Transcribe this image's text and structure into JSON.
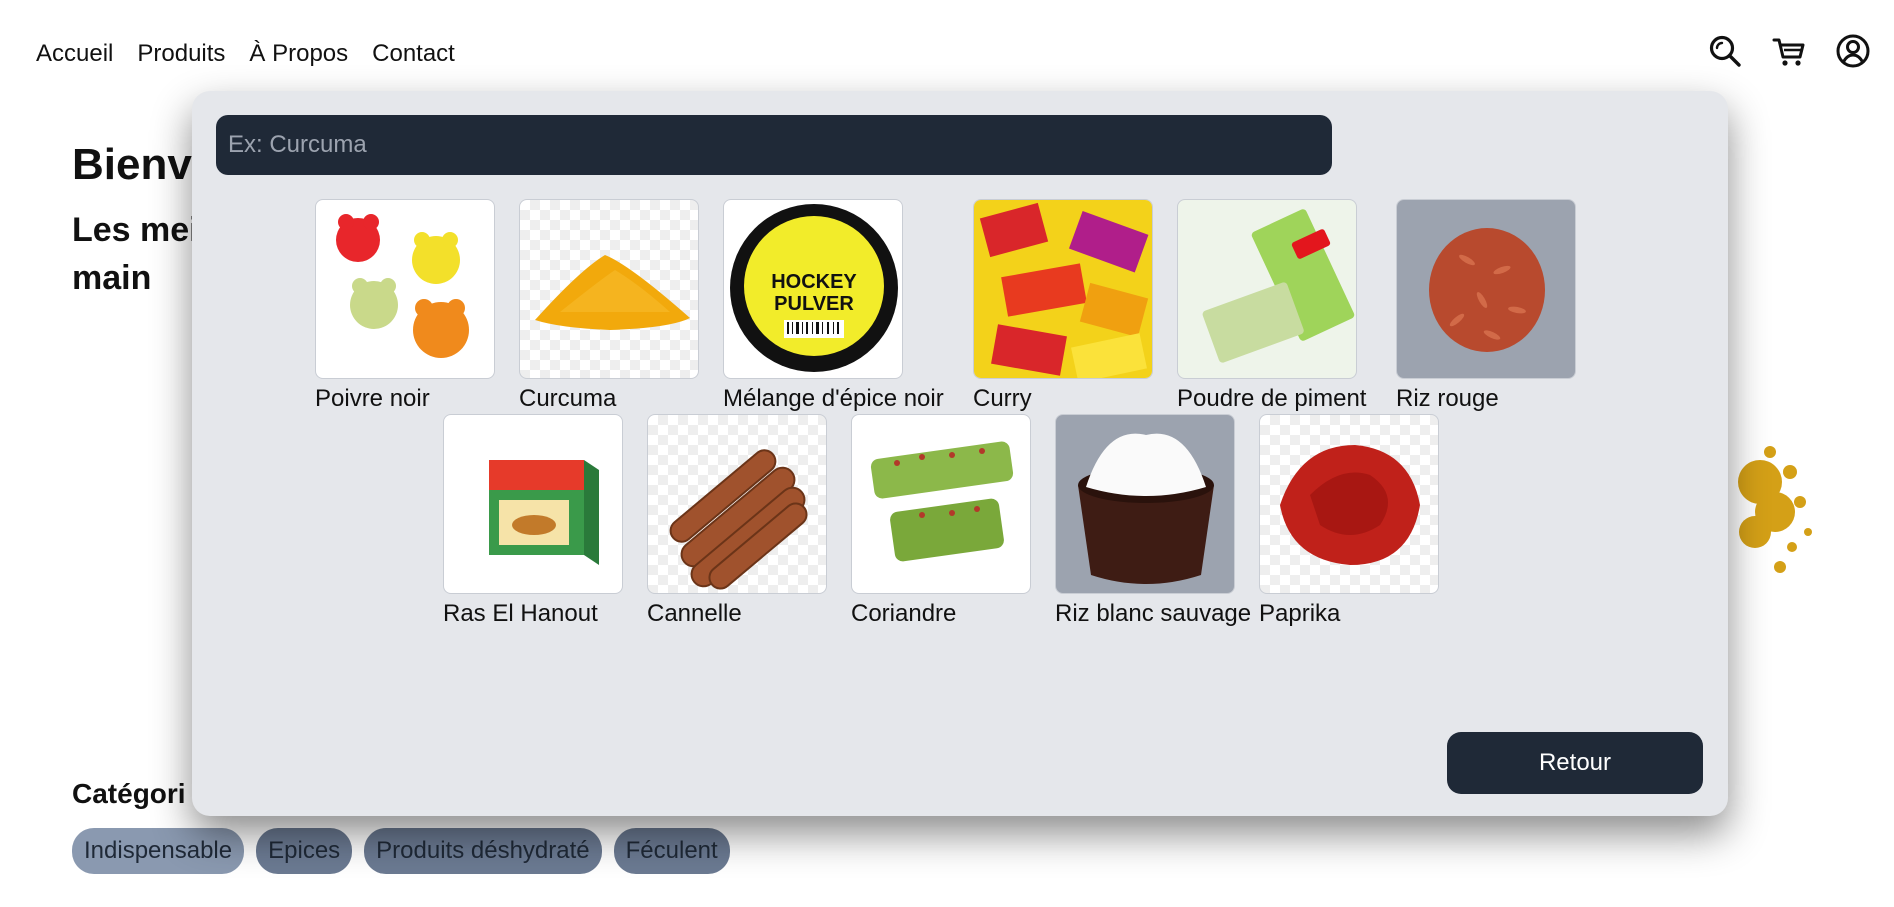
{
  "nav": {
    "links": [
      "Accueil",
      "Produits",
      "À Propos",
      "Contact"
    ],
    "icons": [
      "search-icon",
      "cart-icon",
      "account-icon"
    ]
  },
  "hero": {
    "title": "Bienv",
    "subtitle": "Les mei\nmain"
  },
  "categories": {
    "title": "Catégori",
    "chips": [
      "Indispensable",
      "Epices",
      "Produits déshydraté",
      "Féculent"
    ]
  },
  "modal": {
    "search_placeholder": "Ex: Curcuma",
    "products": [
      {
        "name": "Poivre noir",
        "image": "gummy-bears"
      },
      {
        "name": "Curcuma",
        "image": "turmeric-powder"
      },
      {
        "name": "Mélange d'épice noir",
        "image": "hockey-pulver-tin"
      },
      {
        "name": "Curry",
        "image": "wrapped-candies"
      },
      {
        "name": "Poudre de piment",
        "image": "matcha-kitkat"
      },
      {
        "name": "Riz rouge",
        "image": "red-rice"
      },
      {
        "name": "Ras El Hanout",
        "image": "candy-kit-box"
      },
      {
        "name": "Cannelle",
        "image": "cinnamon-sticks"
      },
      {
        "name": "Coriandre",
        "image": "green-chocolate-bars"
      },
      {
        "name": "Riz blanc sauvage",
        "image": "white-rice-bowl"
      },
      {
        "name": "Paprika",
        "image": "paprika-powder"
      }
    ],
    "back_label": "Retour"
  }
}
